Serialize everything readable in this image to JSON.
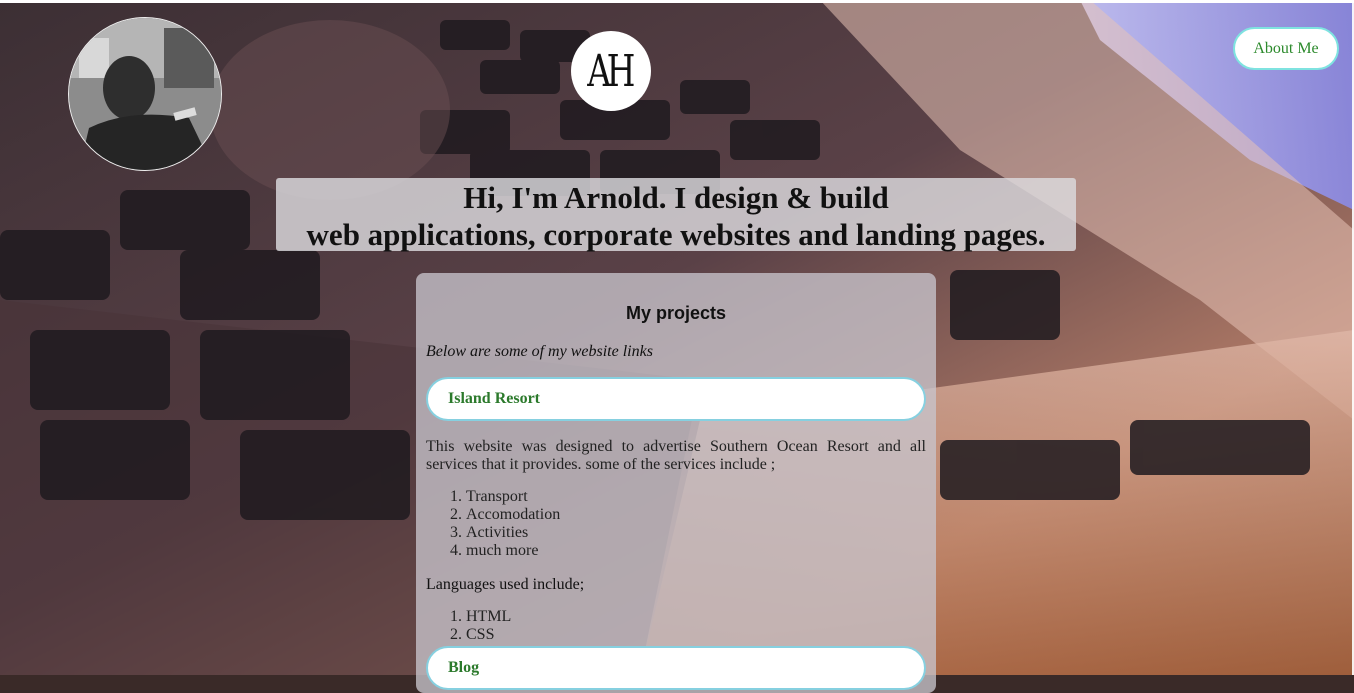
{
  "header": {
    "logo_text": "AH",
    "about_label": "About Me",
    "avatar": "profile-photo"
  },
  "hero": {
    "line1": "Hi, I'm Arnold. I design & build",
    "line2": "web applications, corporate websites and landing pages."
  },
  "projects": {
    "title": "My projects",
    "intro": "Below are some of my website links",
    "items": [
      {
        "label": "Island Resort",
        "description": "This website was designed to advertise Southern Ocean Resort and all services that it provides. some of the services include ;",
        "services": [
          "Transport",
          "Accomodation",
          "Activities",
          "much more"
        ],
        "languages_label": "Languages used include;",
        "languages": [
          "HTML",
          "CSS"
        ]
      },
      {
        "label": "Blog"
      }
    ]
  },
  "colors": {
    "button_border": "#7fe3e0",
    "link_text": "#2c8a2c"
  }
}
